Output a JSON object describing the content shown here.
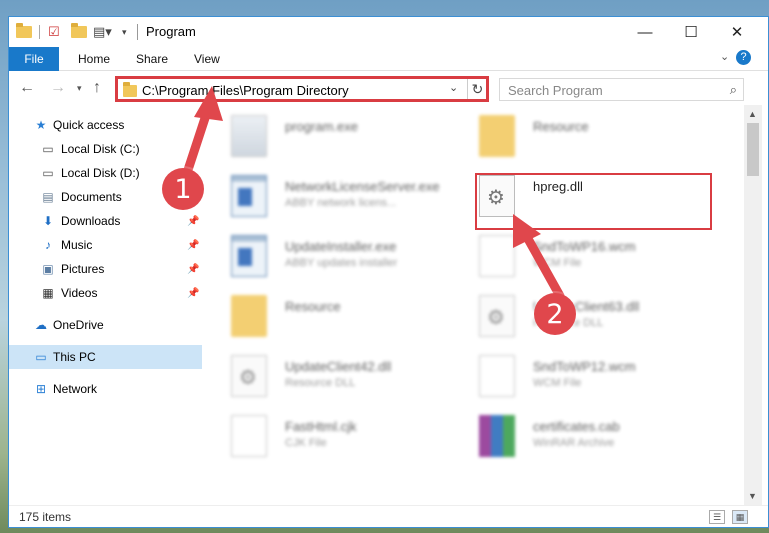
{
  "window": {
    "title": "Program"
  },
  "ribbon": {
    "file": "File",
    "tabs": [
      "Home",
      "Share",
      "View"
    ]
  },
  "address": {
    "path": "C:\\Program Files\\Program Directory"
  },
  "search": {
    "placeholder": "Search Program"
  },
  "nav": {
    "quick_access": "Quick access",
    "items": [
      {
        "label": "Local Disk (C:)",
        "icon": "drive-icon"
      },
      {
        "label": "Local Disk (D:)",
        "icon": "drive-icon"
      },
      {
        "label": "Documents",
        "icon": "documents-icon"
      },
      {
        "label": "Downloads",
        "icon": "download-icon",
        "pinned": true
      },
      {
        "label": "Music",
        "icon": "music-icon",
        "pinned": true
      },
      {
        "label": "Pictures",
        "icon": "pictures-icon",
        "pinned": true
      },
      {
        "label": "Videos",
        "icon": "videos-icon",
        "pinned": true
      }
    ],
    "onedrive": "OneDrive",
    "thispc": "This PC",
    "network": "Network"
  },
  "files": {
    "left": [
      {
        "name": "program.exe",
        "desc": "",
        "type": "installer"
      },
      {
        "name": "NetworkLicenseServer.exe",
        "desc": "ABBY network licens...",
        "type": "exe"
      },
      {
        "name": "UpdateInstaller.exe",
        "desc": "ABBY updates installer",
        "type": "exe"
      },
      {
        "name": "Resource",
        "desc": "",
        "type": "folder"
      },
      {
        "name": "UpdateClient42.dll",
        "desc": "Resource DLL",
        "type": "dll"
      },
      {
        "name": "FastHtml.cjk",
        "desc": "CJK File",
        "type": "doc"
      }
    ],
    "right": [
      {
        "name": "Resource",
        "desc": "",
        "type": "folder"
      },
      {
        "name": "hpreg.dll",
        "desc": "",
        "type": "dll"
      },
      {
        "name": "SndToWP16.wcm",
        "desc": "WCM File",
        "type": "doc"
      },
      {
        "name": "UpdateClient63.dll",
        "desc": "Resource DLL",
        "type": "dll"
      },
      {
        "name": "SndToWP12.wcm",
        "desc": "WCM File",
        "type": "doc"
      },
      {
        "name": "certificates.cab",
        "desc": "WinRAR Archive",
        "type": "cab"
      }
    ]
  },
  "status": {
    "items": "175 items"
  },
  "annotations": {
    "step1": "1",
    "step2": "2"
  },
  "colors": {
    "accent": "#1979ca",
    "highlight": "#d93c42",
    "selection": "#cce4f7"
  }
}
